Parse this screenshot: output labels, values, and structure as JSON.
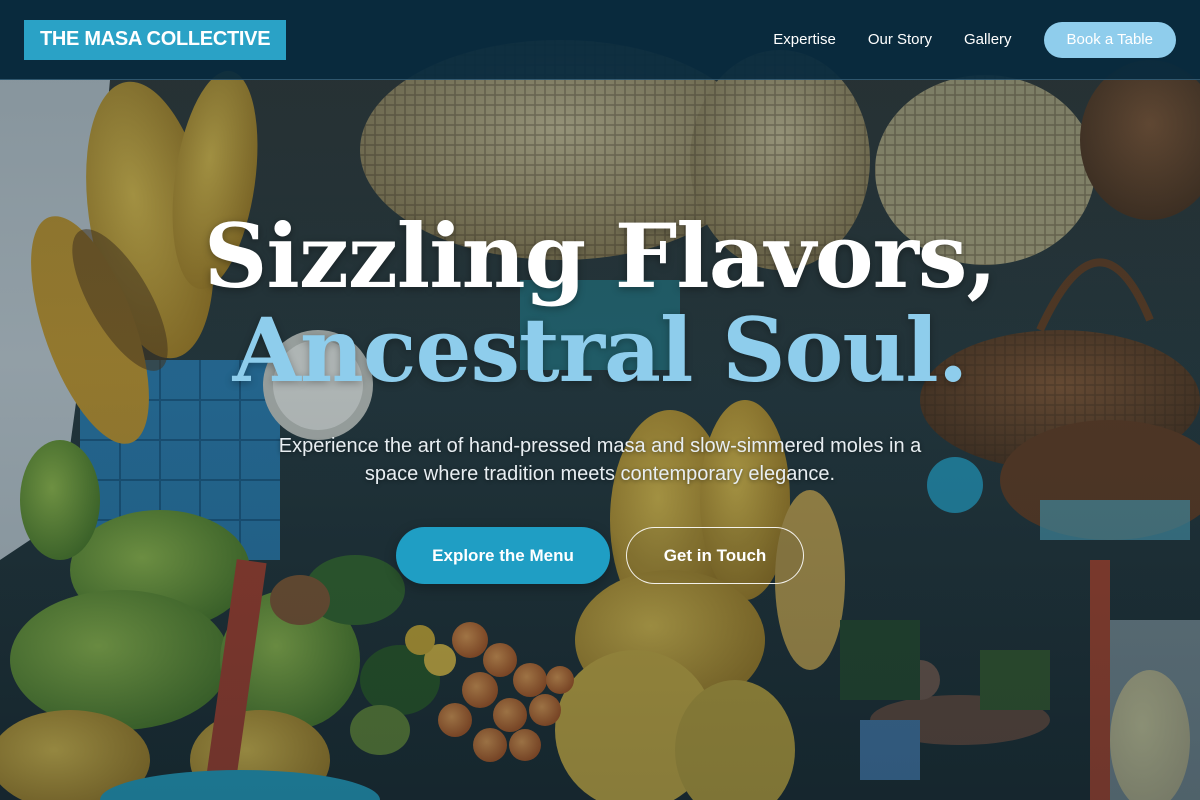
{
  "header": {
    "logo_text": "THE MASA COLLECTIVE",
    "nav": [
      {
        "label": "Expertise"
      },
      {
        "label": "Our Story"
      },
      {
        "label": "Gallery"
      }
    ],
    "cta_label": "Book a Table"
  },
  "hero": {
    "headline_line1": "Sizzling Flavors,",
    "headline_line2": "Ancestral Soul.",
    "subtitle": "Experience the art of hand-pressed masa and slow-simmered moles in a space where tradition meets contemporary elegance.",
    "primary_cta": "Explore the Menu",
    "secondary_cta": "Get in Touch",
    "background_image": "market-stall-bananas-baskets-photo"
  },
  "colors": {
    "header_bg": "#072a3e",
    "brand_accent": "#2aa2c6",
    "book_button": "#8fcdec",
    "headline_accent": "#8ecdec",
    "primary_button": "#1f9ec4"
  }
}
